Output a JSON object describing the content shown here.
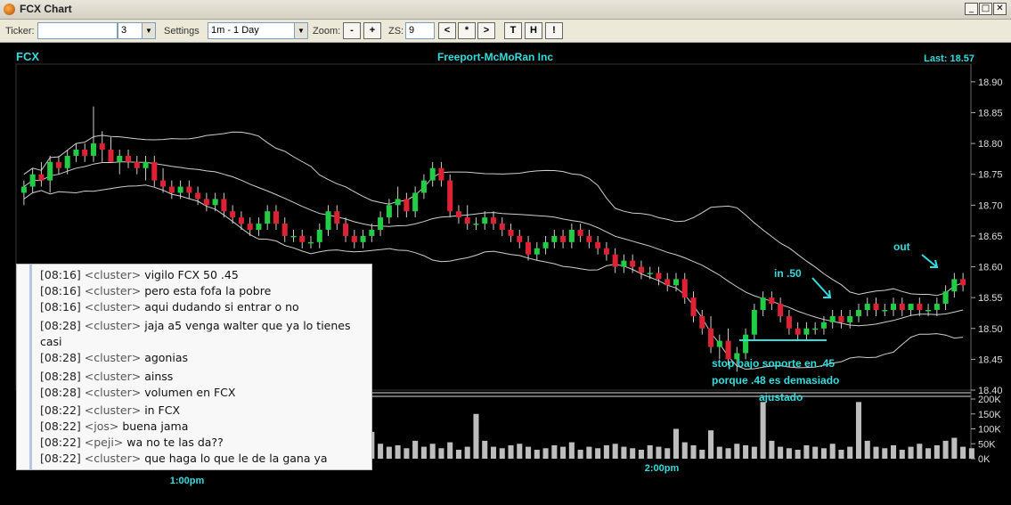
{
  "window": {
    "title": "FCX Chart",
    "buttons": {
      "minimize": "_",
      "maximize": "□",
      "close": "✕"
    }
  },
  "toolbar": {
    "ticker_label": "Ticker:",
    "ticker_value": "",
    "count_value": "3",
    "settings_label": "Settings",
    "settings_value": "1m - 1 Day",
    "zoom_label": "Zoom:",
    "zoom_minus": "-",
    "zoom_plus": "+",
    "zs_label": "ZS:",
    "zs_value": "9",
    "nav_prev": "<",
    "nav_star": "*",
    "nav_next": ">",
    "btn_t": "T",
    "btn_h": "H",
    "btn_excl": "!"
  },
  "chart": {
    "symbol": "FCX",
    "company": "Freeport-McMoRan Inc",
    "last_label": "Last: 18.57",
    "price_ticks": [
      "18.90",
      "18.85",
      "18.80",
      "18.75",
      "18.70",
      "18.65",
      "18.60",
      "18.55",
      "18.50",
      "18.45",
      "18.40"
    ],
    "volume_ticks": [
      "200K",
      "150K",
      "100K",
      "50K",
      "0K"
    ],
    "time_labels": [
      "1:00pm",
      "2:00pm"
    ],
    "annotations": {
      "out": "out",
      "in": "in .50",
      "stop_line1": "stop bajo soporte en .45",
      "stop_line2": "porque .48 es demasiado",
      "stop_line3": "ajustado"
    },
    "colors": {
      "up": "#22cc44",
      "down": "#dd2233",
      "annotation": "#33dddd",
      "header": "#33dddd",
      "band": "#cfcfcf",
      "volume": "#bdbdbd"
    }
  },
  "chart_data": {
    "type": "candlestick",
    "title": "Freeport-McMoRan Inc",
    "symbol": "FCX",
    "ylim": [
      18.4,
      18.92
    ],
    "volume_ylim": [
      0,
      200000
    ],
    "x_tick_labels": [
      "1:00pm",
      "2:00pm"
    ],
    "candles_ohlc": [
      [
        18.72,
        18.74,
        18.7,
        18.73
      ],
      [
        18.73,
        18.76,
        18.72,
        18.75
      ],
      [
        18.75,
        18.77,
        18.73,
        18.74
      ],
      [
        18.74,
        18.78,
        18.72,
        18.77
      ],
      [
        18.77,
        18.78,
        18.75,
        18.76
      ],
      [
        18.76,
        18.79,
        18.75,
        18.78
      ],
      [
        18.78,
        18.8,
        18.77,
        18.79
      ],
      [
        18.79,
        18.8,
        18.77,
        18.78
      ],
      [
        18.78,
        18.86,
        18.77,
        18.8
      ],
      [
        18.8,
        18.82,
        18.77,
        18.79
      ],
      [
        18.79,
        18.81,
        18.77,
        18.77
      ],
      [
        18.77,
        18.79,
        18.75,
        18.78
      ],
      [
        18.78,
        18.79,
        18.76,
        18.77
      ],
      [
        18.77,
        18.78,
        18.75,
        18.76
      ],
      [
        18.76,
        18.78,
        18.74,
        18.77
      ],
      [
        18.77,
        18.78,
        18.73,
        18.74
      ],
      [
        18.74,
        18.76,
        18.72,
        18.73
      ],
      [
        18.73,
        18.74,
        18.71,
        18.72
      ],
      [
        18.72,
        18.74,
        18.71,
        18.73
      ],
      [
        18.73,
        18.74,
        18.71,
        18.72
      ],
      [
        18.72,
        18.73,
        18.7,
        18.71
      ],
      [
        18.71,
        18.72,
        18.69,
        18.7
      ],
      [
        18.7,
        18.72,
        18.69,
        18.71
      ],
      [
        18.71,
        18.72,
        18.68,
        18.69
      ],
      [
        18.69,
        18.7,
        18.67,
        18.68
      ],
      [
        18.68,
        18.69,
        18.66,
        18.67
      ],
      [
        18.67,
        18.68,
        18.65,
        18.66
      ],
      [
        18.66,
        18.68,
        18.65,
        18.67
      ],
      [
        18.67,
        18.7,
        18.66,
        18.69
      ],
      [
        18.69,
        18.7,
        18.66,
        18.67
      ],
      [
        18.67,
        18.68,
        18.64,
        18.65
      ],
      [
        18.65,
        18.66,
        18.64,
        18.65
      ],
      [
        18.65,
        18.66,
        18.63,
        18.64
      ],
      [
        18.64,
        18.65,
        18.63,
        18.64
      ],
      [
        18.64,
        18.67,
        18.63,
        18.66
      ],
      [
        18.66,
        18.7,
        18.65,
        18.69
      ],
      [
        18.69,
        18.7,
        18.66,
        18.67
      ],
      [
        18.67,
        18.68,
        18.64,
        18.65
      ],
      [
        18.65,
        18.66,
        18.63,
        18.64
      ],
      [
        18.64,
        18.66,
        18.63,
        18.65
      ],
      [
        18.65,
        18.67,
        18.64,
        18.66
      ],
      [
        18.66,
        18.69,
        18.65,
        18.68
      ],
      [
        18.68,
        18.71,
        18.67,
        18.7
      ],
      [
        18.7,
        18.73,
        18.68,
        18.71
      ],
      [
        18.71,
        18.72,
        18.68,
        18.69
      ],
      [
        18.69,
        18.73,
        18.68,
        18.72
      ],
      [
        18.72,
        18.75,
        18.71,
        18.74
      ],
      [
        18.74,
        18.77,
        18.73,
        18.76
      ],
      [
        18.76,
        18.77,
        18.73,
        18.74
      ],
      [
        18.74,
        18.75,
        18.68,
        18.69
      ],
      [
        18.69,
        18.7,
        18.67,
        18.68
      ],
      [
        18.68,
        18.7,
        18.66,
        18.67
      ],
      [
        18.67,
        18.68,
        18.66,
        18.67
      ],
      [
        18.67,
        18.69,
        18.66,
        18.68
      ],
      [
        18.68,
        18.69,
        18.66,
        18.67
      ],
      [
        18.67,
        18.68,
        18.65,
        18.66
      ],
      [
        18.66,
        18.67,
        18.64,
        18.65
      ],
      [
        18.65,
        18.66,
        18.63,
        18.64
      ],
      [
        18.64,
        18.65,
        18.61,
        18.62
      ],
      [
        18.62,
        18.64,
        18.61,
        18.63
      ],
      [
        18.63,
        18.65,
        18.62,
        18.64
      ],
      [
        18.64,
        18.66,
        18.63,
        18.65
      ],
      [
        18.65,
        18.66,
        18.63,
        18.64
      ],
      [
        18.64,
        18.67,
        18.63,
        18.66
      ],
      [
        18.66,
        18.67,
        18.64,
        18.65
      ],
      [
        18.65,
        18.66,
        18.63,
        18.64
      ],
      [
        18.64,
        18.65,
        18.62,
        18.63
      ],
      [
        18.63,
        18.64,
        18.61,
        18.62
      ],
      [
        18.62,
        18.63,
        18.59,
        18.6
      ],
      [
        18.6,
        18.62,
        18.59,
        18.61
      ],
      [
        18.61,
        18.62,
        18.59,
        18.6
      ],
      [
        18.6,
        18.61,
        18.58,
        18.59
      ],
      [
        18.59,
        18.6,
        18.58,
        18.59
      ],
      [
        18.59,
        18.6,
        18.57,
        18.58
      ],
      [
        18.58,
        18.59,
        18.56,
        18.57
      ],
      [
        18.57,
        18.59,
        18.56,
        18.58
      ],
      [
        18.58,
        18.59,
        18.54,
        18.55
      ],
      [
        18.55,
        18.56,
        18.51,
        18.52
      ],
      [
        18.52,
        18.53,
        18.49,
        18.5
      ],
      [
        18.5,
        18.52,
        18.46,
        18.47
      ],
      [
        18.47,
        18.49,
        18.45,
        18.48
      ],
      [
        18.48,
        18.5,
        18.44,
        18.45
      ],
      [
        18.45,
        18.47,
        18.43,
        18.46
      ],
      [
        18.46,
        18.5,
        18.45,
        18.49
      ],
      [
        18.49,
        18.54,
        18.48,
        18.53
      ],
      [
        18.53,
        18.56,
        18.52,
        18.55
      ],
      [
        18.55,
        18.56,
        18.53,
        18.54
      ],
      [
        18.54,
        18.55,
        18.51,
        18.52
      ],
      [
        18.52,
        18.53,
        18.49,
        18.5
      ],
      [
        18.5,
        18.51,
        18.48,
        18.49
      ],
      [
        18.49,
        18.51,
        18.48,
        18.5
      ],
      [
        18.5,
        18.51,
        18.49,
        18.5
      ],
      [
        18.5,
        18.52,
        18.49,
        18.51
      ],
      [
        18.51,
        18.53,
        18.5,
        18.52
      ],
      [
        18.52,
        18.53,
        18.5,
        18.51
      ],
      [
        18.51,
        18.53,
        18.5,
        18.52
      ],
      [
        18.52,
        18.54,
        18.51,
        18.53
      ],
      [
        18.53,
        18.55,
        18.52,
        18.54
      ],
      [
        18.54,
        18.55,
        18.52,
        18.53
      ],
      [
        18.53,
        18.54,
        18.52,
        18.53
      ],
      [
        18.53,
        18.55,
        18.52,
        18.54
      ],
      [
        18.54,
        18.55,
        18.52,
        18.53
      ],
      [
        18.53,
        18.54,
        18.52,
        18.54
      ],
      [
        18.54,
        18.55,
        18.52,
        18.53
      ],
      [
        18.53,
        18.54,
        18.52,
        18.53
      ],
      [
        18.53,
        18.55,
        18.52,
        18.54
      ],
      [
        18.54,
        18.57,
        18.53,
        18.56
      ],
      [
        18.56,
        18.59,
        18.55,
        18.58
      ],
      [
        18.58,
        18.59,
        18.56,
        18.57
      ]
    ],
    "volume": [
      60000,
      40000,
      30000,
      45000,
      55000,
      35000,
      50000,
      60000,
      70000,
      40000,
      30000,
      35000,
      45000,
      25000,
      30000,
      50000,
      40000,
      35000,
      30000,
      45000,
      55000,
      40000,
      35000,
      30000,
      50000,
      45000,
      40000,
      60000,
      35000,
      30000,
      45000,
      40000,
      55000,
      30000,
      40000,
      70000,
      60000,
      45000,
      35000,
      40000,
      90000,
      50000,
      40000,
      45000,
      35000,
      60000,
      40000,
      50000,
      35000,
      55000,
      30000,
      40000,
      150000,
      60000,
      40000,
      35000,
      45000,
      50000,
      40000,
      30000,
      35000,
      45000,
      40000,
      55000,
      30000,
      40000,
      35000,
      45000,
      50000,
      40000,
      35000,
      30000,
      45000,
      40000,
      35000,
      100000,
      55000,
      45000,
      30000,
      95000,
      40000,
      35000,
      50000,
      45000,
      40000,
      190000,
      60000,
      40000,
      35000,
      30000,
      45000,
      40000,
      35000,
      50000,
      30000,
      40000,
      190000,
      60000,
      40000,
      35000,
      45000,
      30000,
      40000,
      50000,
      35000,
      45000,
      60000,
      70000,
      40000,
      35000
    ]
  }
}
